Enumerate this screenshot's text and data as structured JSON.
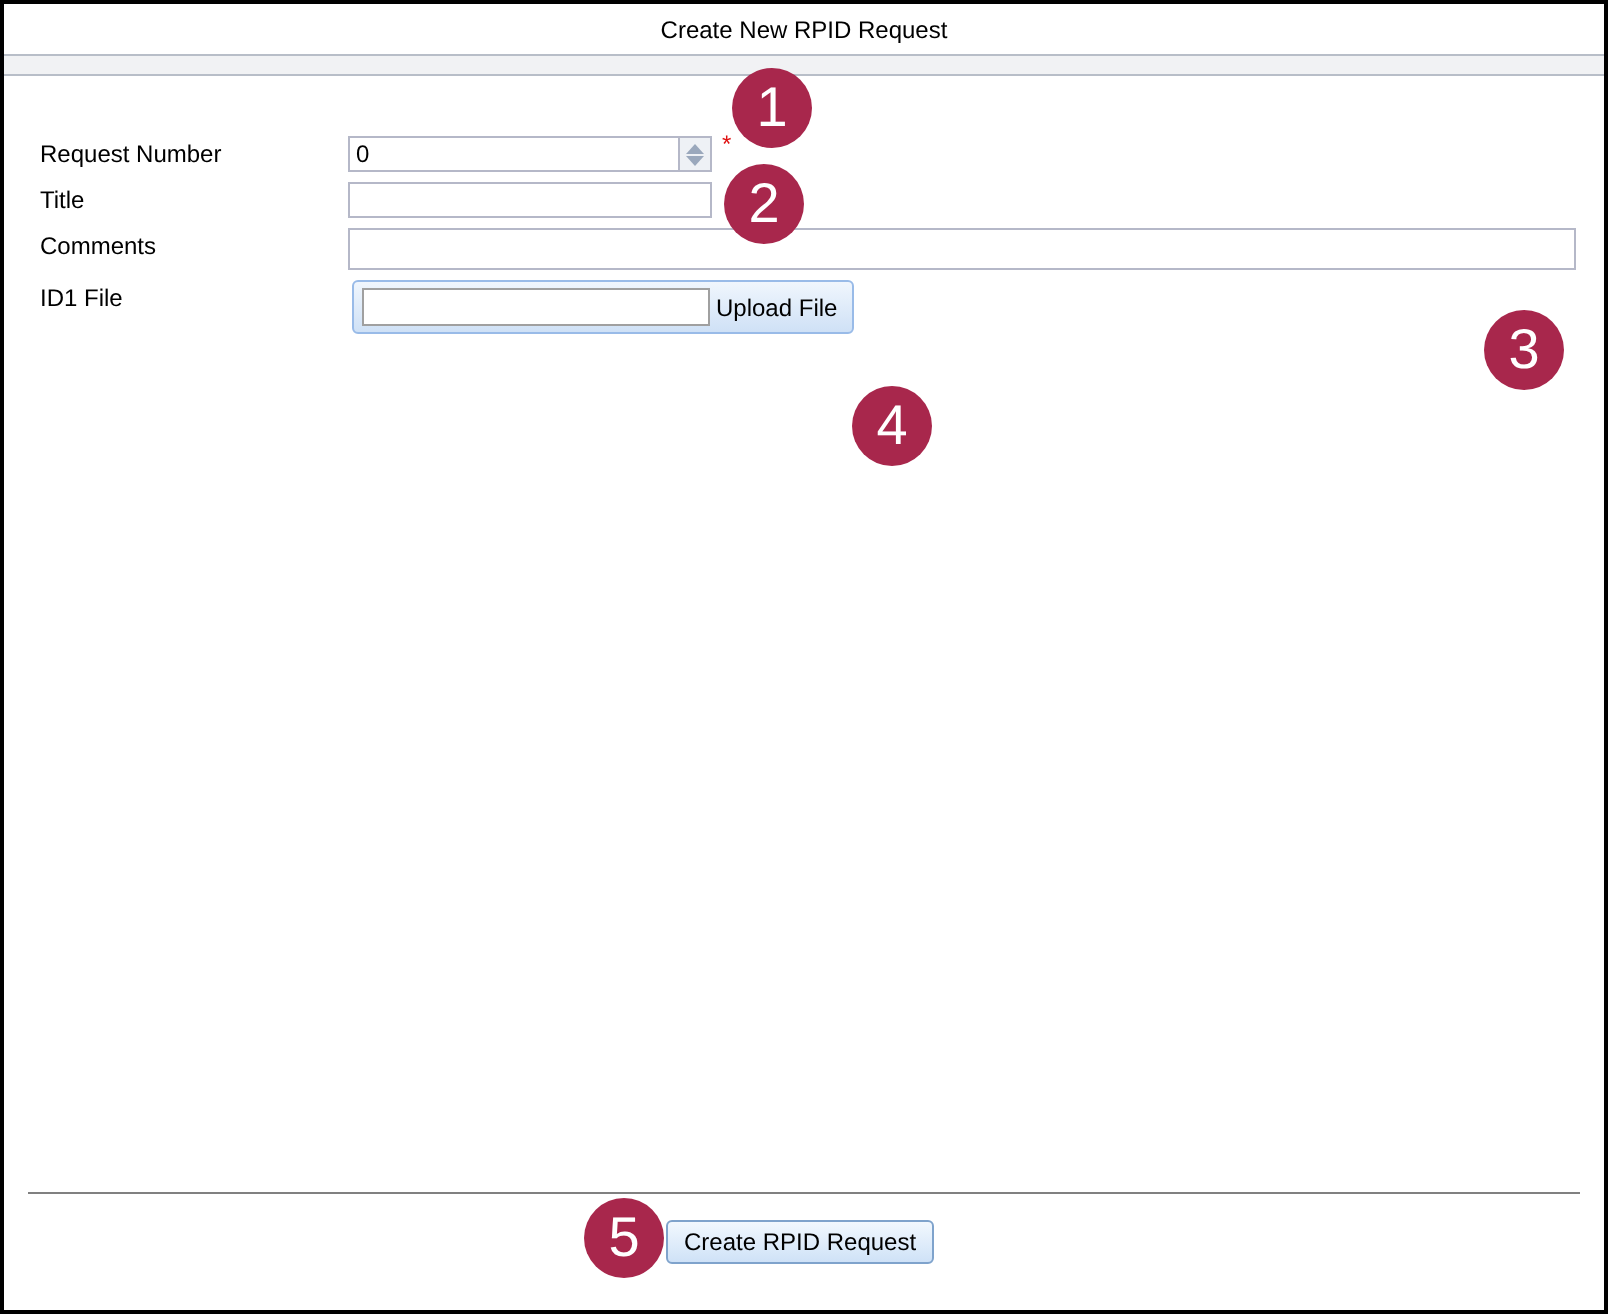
{
  "window": {
    "title": "Create New RPID Request"
  },
  "fields": [
    {
      "label": "Request Number",
      "kind": "number",
      "value": "0",
      "required_mark": "*"
    },
    {
      "label": "Title",
      "kind": "text"
    },
    {
      "label": "Comments",
      "kind": "wide"
    },
    {
      "label": "ID1 File",
      "kind": "file",
      "button": "Upload File"
    }
  ],
  "submit_button": "Create RPID Request",
  "callouts": [
    {
      "label": "1"
    },
    {
      "label": "2"
    },
    {
      "label": "3"
    },
    {
      "label": "4"
    },
    {
      "label": "5"
    }
  ]
}
